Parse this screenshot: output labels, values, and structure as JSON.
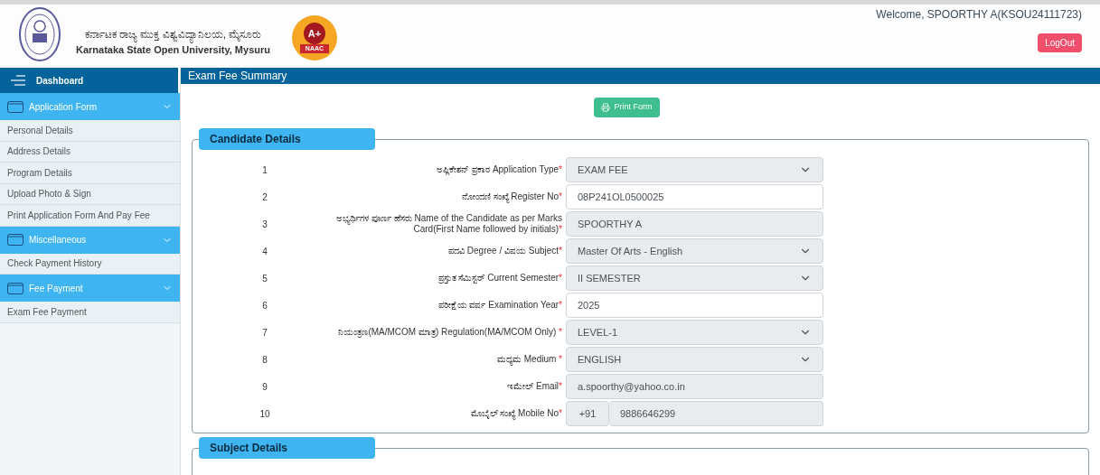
{
  "header": {
    "title_kannada": "ಕರ್ನಾಟಕ ರಾಜ್ಯ ಮುಕ್ತ ವಿಶ್ವವಿದ್ಯಾನಿಲಯ, ಮೈಸೂರು",
    "title_english": "Karnataka State Open University, Mysuru",
    "badge": {
      "grade": "A+",
      "label": "NAAC"
    },
    "welcome": "Welcome, SPOORTHY A(KSOU24111723)",
    "logout": "LogOut"
  },
  "sidebar": {
    "title": "Dashboard",
    "sections": [
      {
        "title": "Application Form",
        "expanded": true,
        "items": [
          "Personal Details",
          "Address Details",
          "Program Details",
          "Upload Photo & Sign",
          "Print Application Form And Pay Fee"
        ]
      },
      {
        "title": "Miscellaneous",
        "expanded": true,
        "items": [
          "Check Payment History"
        ]
      },
      {
        "title": "Fee Payment",
        "expanded": true,
        "items": [
          "Exam Fee Payment"
        ]
      }
    ]
  },
  "page": {
    "title": "Exam Fee Summary",
    "print_button": "Print Form",
    "candidate_details": {
      "legend": "Candidate Details",
      "rows": [
        {
          "number": "1",
          "label": "ಅಪ್ಲಿಕೇಶನ್ ಪ್ರಕಾರ Application Type",
          "required_mark": "*",
          "kind": "select",
          "disabled": true,
          "value": "EXAM FEE"
        },
        {
          "number": "2",
          "label": "ನೋಂದಣಿ ಸಂಖ್ಯೆ Register No",
          "required_mark": "*",
          "kind": "text",
          "disabled": false,
          "value": "08P241OL0500025"
        },
        {
          "number": "3",
          "label": "ಅಭ್ಯರ್ಥಿಗಳ ಪೂರ್ಣ ಹೆಸರು Name of the Candidate as per Marks Card(First Name followed by initials)",
          "required_mark": "*",
          "kind": "text",
          "disabled": true,
          "value": "SPOORTHY A"
        },
        {
          "number": "4",
          "label": "ಪದವಿ Degree / ವಿಷಯ Subject",
          "required_mark": "*",
          "kind": "select",
          "disabled": true,
          "value": "Master Of Arts - English"
        },
        {
          "number": "5",
          "label": "ಪ್ರಸ್ತುತ ಸೆಮಿಸ್ಟರ್ Current Semester",
          "required_mark": "*",
          "kind": "select",
          "disabled": true,
          "value": "II SEMESTER"
        },
        {
          "number": "6",
          "label": "ಪರೀಕ್ಷೆಯ ವರ್ಷ Examination Year",
          "required_mark": "*",
          "kind": "text",
          "disabled": false,
          "value": "2025"
        },
        {
          "number": "7",
          "label": "ನಿಯಂತ್ರಣ(MA/MCOM ಮಾತ್ರ) Regulation(MA/MCOM Only) ",
          "required_mark": "*",
          "kind": "select",
          "disabled": true,
          "value": "LEVEL-1"
        },
        {
          "number": "8",
          "label": "ಮಧ್ಯಮ Medium ",
          "required_mark": "*",
          "kind": "select",
          "disabled": true,
          "value": "ENGLISH"
        },
        {
          "number": "9",
          "label": "ಇಮೇಲ್ Email",
          "required_mark": "*",
          "kind": "text",
          "disabled": true,
          "value": "a.spoorthy@yahoo.co.in"
        },
        {
          "number": "10",
          "label": "ಮೊಬೈಲ್ ಸಂಖ್ಯೆ Mobile No",
          "required_mark": "*",
          "kind": "phone",
          "disabled": true,
          "prefix": "+91",
          "value": "9886646299"
        }
      ]
    },
    "subject_details": {
      "legend": "Subject Details"
    }
  }
}
